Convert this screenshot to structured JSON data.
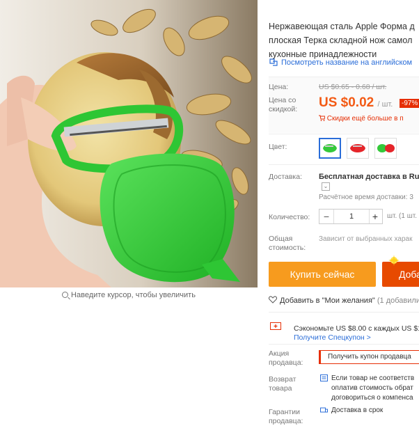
{
  "product": {
    "title_lines": [
      "Нержавеющая сталь Apple Форма д",
      "плоская Терка складной нож самол",
      "кухонные принадлежности"
    ],
    "translate_link": "Посмотреть название на английском",
    "zoom_hint": "Наведите курсор, чтобы увеличить"
  },
  "price": {
    "price_label": "Цена:",
    "old_price": "US $0.65 - 0.68 / шт.",
    "discount_label": "Цена со скидкой:",
    "new_price": "US $0.02",
    "new_price_unit": "/ шт.",
    "discount_badge": "-97%",
    "bulk_note": "Скидки ещё больше в п"
  },
  "options": {
    "color_label": "Цвет:",
    "swatches": [
      "green",
      "red",
      "mixed"
    ],
    "colors": {
      "green": "#34c93a",
      "red": "#e5252a",
      "accent": "#f35a14",
      "link": "#2a6dd8"
    }
  },
  "shipping": {
    "label": "Доставка:",
    "title": "Бесплатная доставка в Rus",
    "time": "Расчётное время доставки: 3"
  },
  "quantity": {
    "label": "Количество:",
    "minus": "−",
    "value": "1",
    "plus": "+",
    "unit_note": "шт. (1 шт."
  },
  "total": {
    "label_line1": "Общая",
    "label_line2": "стоимость:",
    "value": "Зависит от выбранных харак"
  },
  "actions": {
    "buy_now": "Купить сейчас",
    "add_to_cart": "Доба",
    "wishlist": "Добавить в \"Мои желания\"",
    "wishlist_count": "(1 добавили"
  },
  "coupon": {
    "text": "Сэкономьте US $8.00 с каждых US $1",
    "link": "Получите Спецкупон >"
  },
  "promo": {
    "label_line1": "Акция",
    "label_line2": "продавца:",
    "button": "Получить купон продавца"
  },
  "returns": {
    "label_line1": "Возврат",
    "label_line2": "товара",
    "lines": [
      "Если товар не соответств",
      "оплатив стоимость обрат",
      "договориться о компенса"
    ]
  },
  "guarantee": {
    "label_line1": "Гарантии",
    "label_line2": "продавца:",
    "text": "Доставка в срок"
  }
}
